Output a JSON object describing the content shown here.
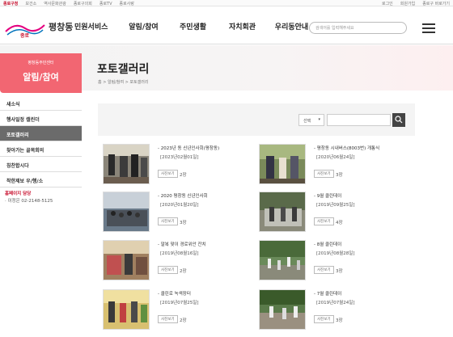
{
  "topbar": {
    "links": [
      "종로구청",
      "보건소",
      "역사문화관광",
      "종로구의회",
      "종로TV",
      "종로사랑"
    ],
    "right": [
      "로그인",
      "회원가입",
      "종로구 바로가기"
    ]
  },
  "header": {
    "dong_name": "평창동",
    "nav": [
      "민원서비스",
      "알림/참여",
      "주민생활",
      "자치회관",
      "우리동안내"
    ],
    "search_placeholder": "검색어를 입력해주세요",
    "logo_text": "종로"
  },
  "sidebar": {
    "subtitle": "평창동주민센터",
    "title": "알림/참여",
    "items": [
      {
        "label": "새소식",
        "active": false
      },
      {
        "label": "행사일정 캘린더",
        "active": false
      },
      {
        "label": "포토갤러리",
        "active": true
      },
      {
        "label": "찾아가는 골목회의",
        "active": false
      },
      {
        "label": "칭찬합시다",
        "active": false
      },
      {
        "label": "착한제보 우/행/소",
        "active": false
      }
    ],
    "contact_title": "홈페이지 담당",
    "contact_person": "이정은 02-2148-5125"
  },
  "page": {
    "title": "포토갤러리",
    "breadcrumb": "홈  >  알림/참여  >  포토갤러리"
  },
  "filter": {
    "select_value": "선택",
    "arrow": "▾"
  },
  "gallery": [
    {
      "title": "2023년 동 신년인사회(평창동)",
      "date": "[2023년02월01일]",
      "badge": "사진보기",
      "count": "2장"
    },
    {
      "title": "평창동 시내버스(8003번) 개통식",
      "date": "[2020년06월24일]",
      "badge": "사진보기",
      "count": "3장"
    },
    {
      "title": "2020 평창동 신년인사회",
      "date": "[2020년01월20일]",
      "badge": "사진보기",
      "count": "3장"
    },
    {
      "title": "9월 클린데이",
      "date": "[2019년09월25일]",
      "badge": "사진보기",
      "count": "4장"
    },
    {
      "title": "말복 맞이 경로위안 잔치",
      "date": "[2019년08월16일]",
      "badge": "사진보기",
      "count": "2장"
    },
    {
      "title": "8월 클린데이",
      "date": "[2019년08월28일]",
      "badge": "사진보기",
      "count": "3장"
    },
    {
      "title": "클린로 녹색장터",
      "date": "[2019년07월25일]",
      "badge": "사진보기",
      "count": "2장"
    },
    {
      "title": "7월 클린데이",
      "date": "[2019년07월24일]",
      "badge": "사진보기",
      "count": "3장"
    }
  ]
}
